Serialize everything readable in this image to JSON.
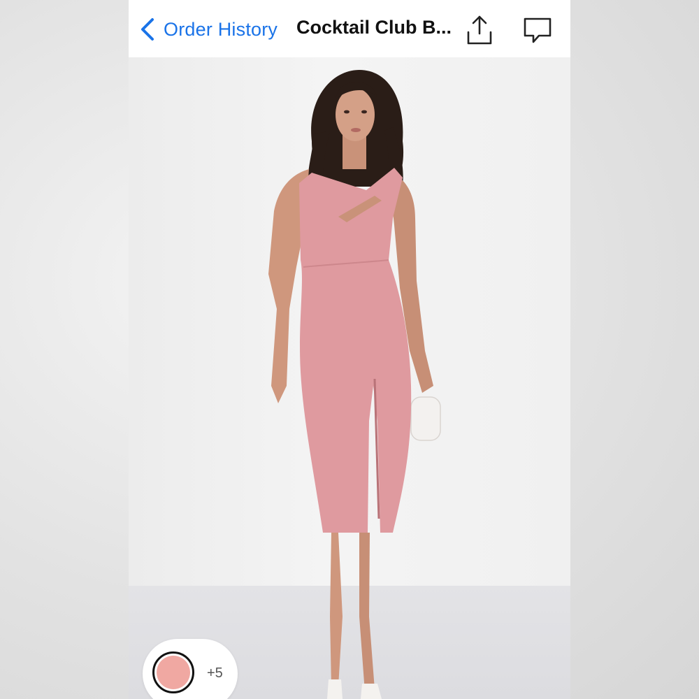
{
  "navbar": {
    "back_label": "Order History",
    "title": "Cocktail Club B...",
    "back_icon": "chevron-left-icon",
    "share_icon": "share-icon",
    "comment_icon": "comment-icon",
    "accent_color": "#1a73e8"
  },
  "product_image": {
    "dress_color": "#df9a9f",
    "background_color": "#f0f0f0"
  },
  "swatches": {
    "selected_color": "#f0a8a2",
    "more_label": "+5"
  }
}
